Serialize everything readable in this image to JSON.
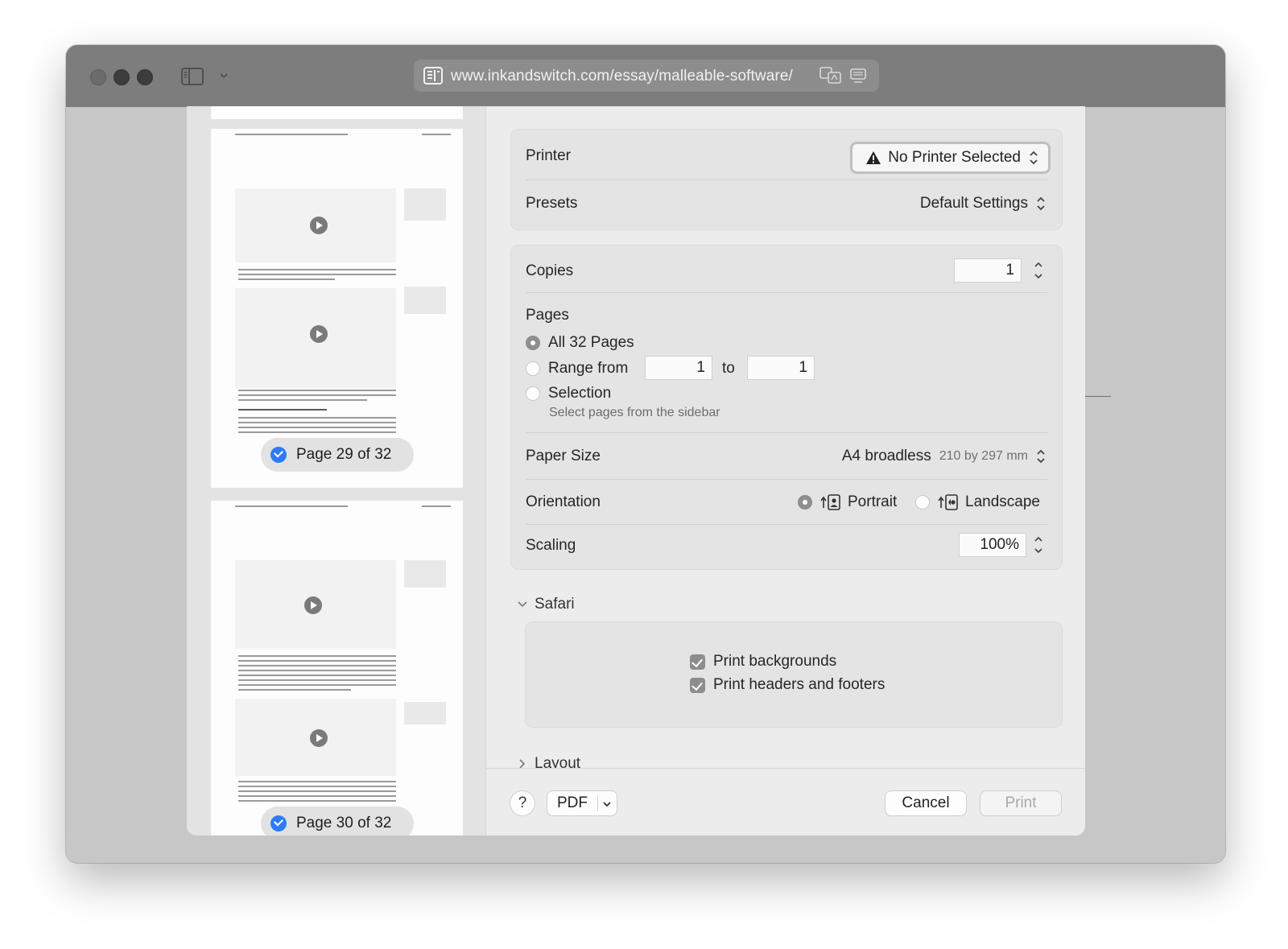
{
  "browser": {
    "url": "www.inkandswitch.com/essay/malleable-software/"
  },
  "thumbnails": [
    {
      "label": "Page 29 of 32",
      "selected": true
    },
    {
      "label": "Page 30 of 32",
      "selected": true
    }
  ],
  "print": {
    "printer_label": "Printer",
    "printer_value": "No Printer Selected",
    "presets_label": "Presets",
    "presets_value": "Default Settings",
    "copies_label": "Copies",
    "copies_value": "1",
    "pages_label": "Pages",
    "pages_all": "All 32 Pages",
    "pages_range": "Range from",
    "range_from": "1",
    "range_to_label": "to",
    "range_to": "1",
    "pages_selection": "Selection",
    "selection_hint": "Select pages from the sidebar",
    "paper_size_label": "Paper Size",
    "paper_size_value": "A4 broadless",
    "paper_size_dims": "210 by 297 mm",
    "orientation_label": "Orientation",
    "orientation_portrait": "Portrait",
    "orientation_landscape": "Landscape",
    "orientation_selected": "Portrait",
    "scaling_label": "Scaling",
    "scaling_value": "100%",
    "safari_section": "Safari",
    "print_backgrounds": "Print backgrounds",
    "print_headers_footers": "Print headers and footers",
    "layout_section": "Layout"
  },
  "footer": {
    "help": "?",
    "pdf": "PDF",
    "cancel": "Cancel",
    "print": "Print"
  },
  "colors": {
    "accent": "#2f7bf5",
    "titlebar": "#7d7d7d",
    "dialog_bg": "#ececec"
  }
}
